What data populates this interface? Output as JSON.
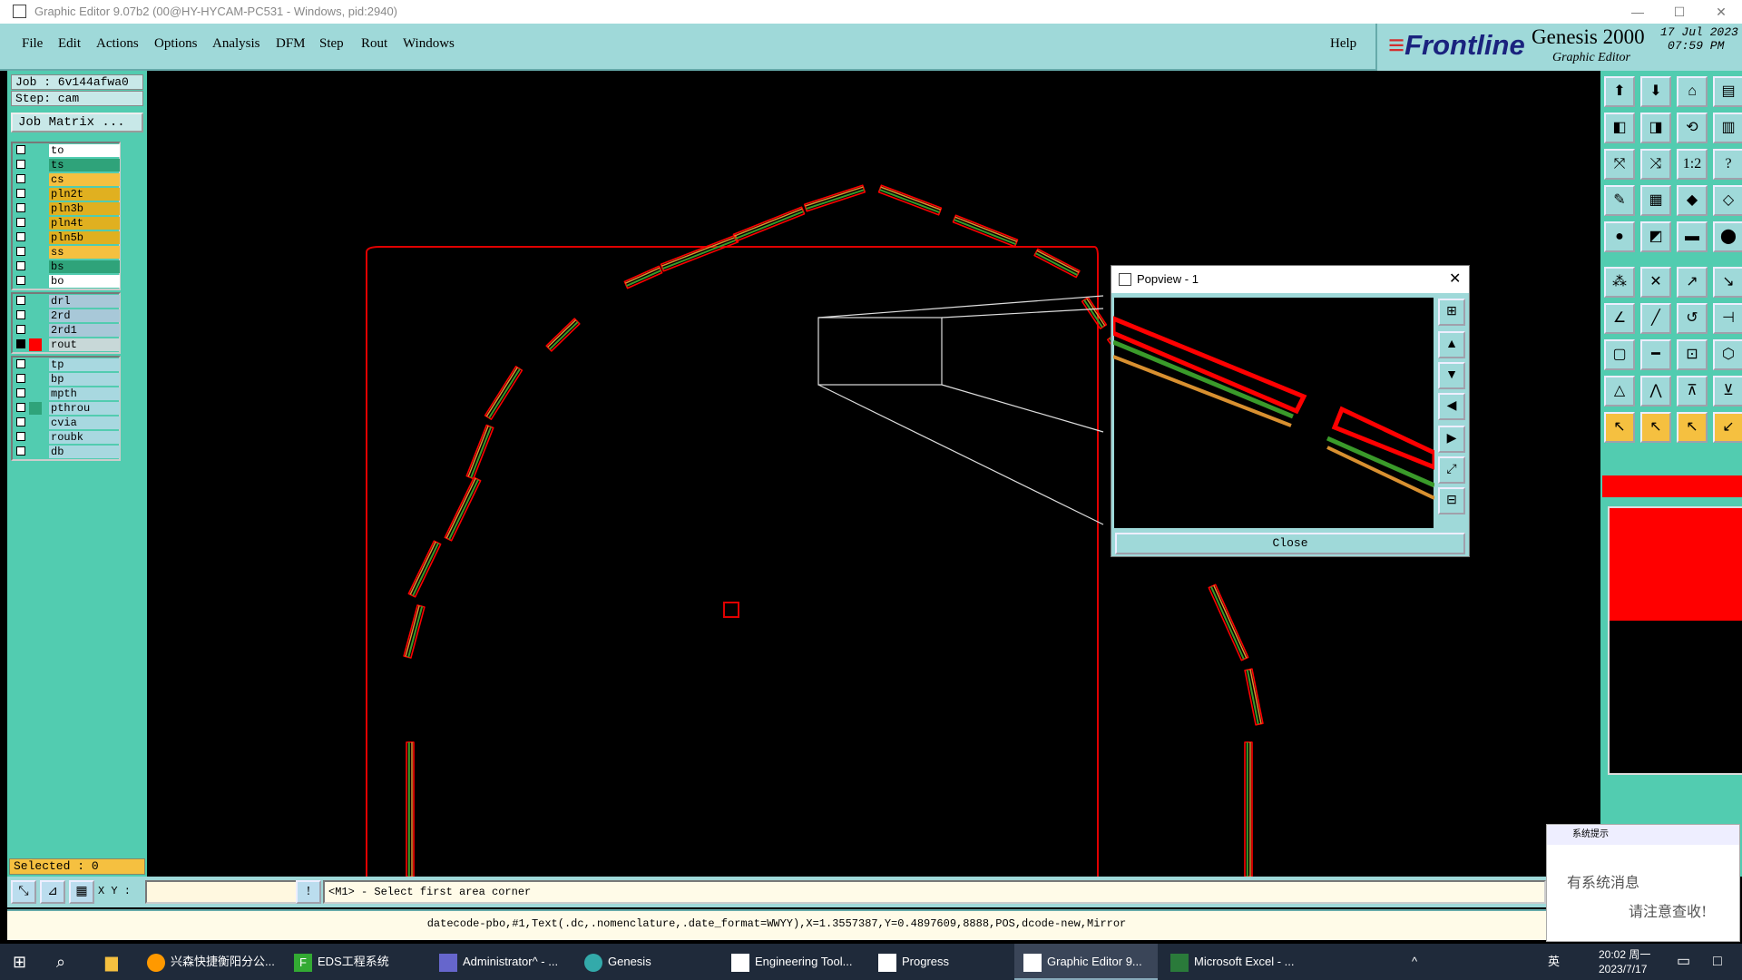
{
  "window": {
    "title": "Graphic Editor 9.07b2 (00@HY-HYCAM-PC531 - Windows, pid:2940)"
  },
  "menu": {
    "items": [
      "File",
      "Edit",
      "Actions",
      "Options",
      "Analysis",
      "DFM",
      "Step",
      "Rout",
      "Windows"
    ],
    "help": "Help"
  },
  "brand": {
    "logo": "Frontline",
    "product": "Genesis 2000",
    "subtitle": "Graphic Editor",
    "date": "17 Jul 2023",
    "time": "07:59 PM"
  },
  "job": {
    "job_label": "Job : 6v144afwa0",
    "step_label": "Step: cam",
    "matrix_button": "Job Matrix ..."
  },
  "layers": {
    "group1": [
      {
        "name": "to",
        "color": "#ffffff"
      },
      {
        "name": "ts",
        "color": "#2fa37a"
      },
      {
        "name": "cs",
        "color": "#f5c040"
      },
      {
        "name": "pln2t",
        "color": "#e0b020"
      },
      {
        "name": "pln3b",
        "color": "#e0b020"
      },
      {
        "name": "pln4t",
        "color": "#e0b020"
      },
      {
        "name": "pln5b",
        "color": "#e0b020"
      },
      {
        "name": "ss",
        "color": "#f5c040"
      },
      {
        "name": "bs",
        "color": "#2fa37a"
      },
      {
        "name": "bo",
        "color": "#ffffff"
      }
    ],
    "group2": [
      {
        "name": "drl",
        "color": "#a8c8d8"
      },
      {
        "name": "2rd",
        "color": "#a8c8d8"
      },
      {
        "name": "2rd1",
        "color": "#a8c8d8"
      },
      {
        "name": "rout",
        "color": "#c8d8d8",
        "swatch": "#ff0000",
        "active": true
      }
    ],
    "group3": [
      {
        "name": "tp",
        "color": "#a8d8e0"
      },
      {
        "name": "bp",
        "color": "#a8d8e0"
      },
      {
        "name": "mpth",
        "color": "#a8d8e0"
      },
      {
        "name": "pthrou",
        "color": "#a8d8e0",
        "swatch": "#2fa37a"
      },
      {
        "name": "cvia",
        "color": "#a8d8e0"
      },
      {
        "name": "roubk",
        "color": "#a8d8e0"
      },
      {
        "name": "db",
        "color": "#a8d8e0"
      }
    ]
  },
  "selected": "Selected : 0",
  "popview": {
    "title": "Popview - 1",
    "close_label": "Close"
  },
  "cmd": {
    "xy_label": "X Y :",
    "xy_value": "",
    "prompt": "<M1> - Select first area corner"
  },
  "status": "datecode-pbo,#1,Text(.dc,.nomenclature,.date_format=WWYY),X=1.3557387,Y=0.4897609,8888,POS,dcode-new,Mirror",
  "notification": {
    "header": "系统提示",
    "line1": "有系统消息",
    "line2": "请注意查收!"
  },
  "taskbar": {
    "items": [
      "兴森快捷衡阳分公...",
      "EDS工程系统",
      "Administrator^ - ...",
      "Genesis",
      "Engineering Tool...",
      "Progress",
      "Graphic Editor 9...",
      "Microsoft Excel - ..."
    ],
    "ime": "英",
    "clock_time": "20:02 周一",
    "clock_date": "2023/7/17"
  },
  "colors": {
    "rout": "#ff0000",
    "pthrou": "#2fa37a",
    "cs": "#f5c040",
    "panel": "#52ccb0",
    "menubar": "#9fd9d9"
  }
}
